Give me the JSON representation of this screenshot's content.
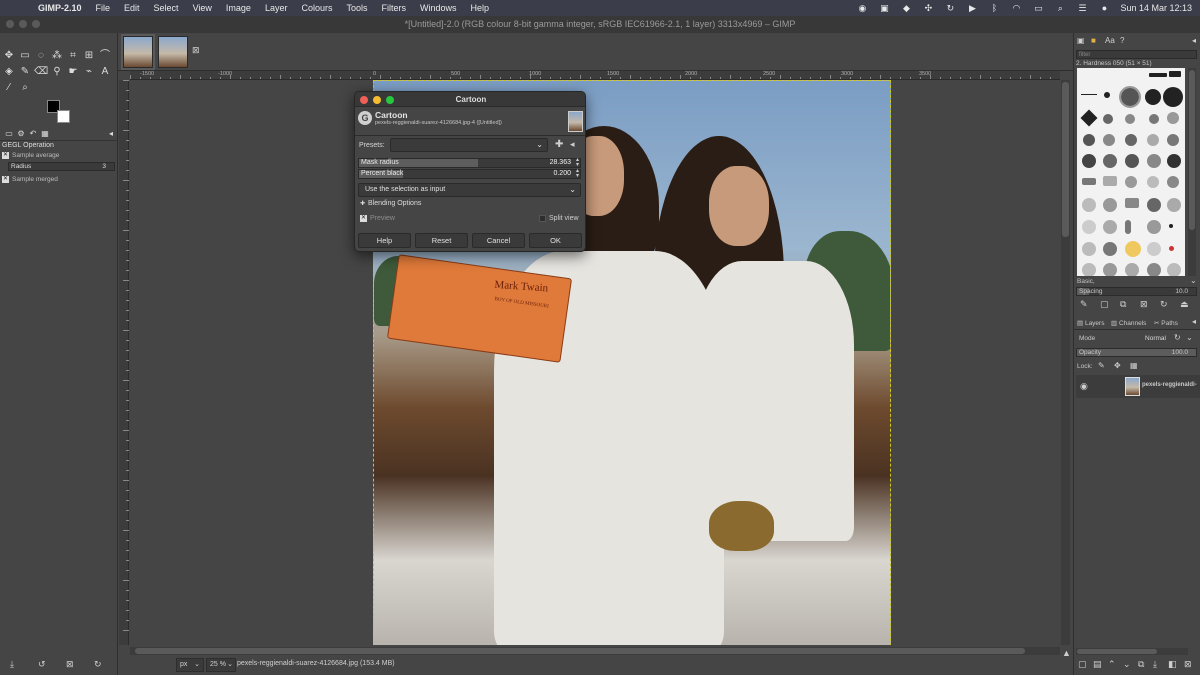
{
  "menubar": {
    "app": "GIMP-2.10",
    "items": [
      "File",
      "Edit",
      "Select",
      "View",
      "Image",
      "Layer",
      "Colours",
      "Tools",
      "Filters",
      "Windows",
      "Help"
    ],
    "clock": "Sun 14 Mar  12:13"
  },
  "window": {
    "title": "*[Untitled]-2.0 (RGB colour 8-bit gamma integer, sRGB IEC61966-2.1, 1 layer) 3313x4969 – GIMP"
  },
  "tool_options": {
    "title": "GEGL Operation",
    "sample_average": "Sample average",
    "radius_label": "Radius",
    "radius_value": "3",
    "sample_merged": "Sample merged"
  },
  "ruler": {
    "h_ticks": [
      "-1500",
      "-1000",
      "0",
      "500",
      "1000",
      "1500",
      "2000",
      "2500",
      "3000",
      "3500"
    ]
  },
  "photo": {
    "book_title": "Mark Twain",
    "book_subtitle": "BOY OF OLD MISSOURI"
  },
  "statusbar": {
    "unit": "px",
    "zoom": "25 %",
    "file_info": "pexels-reggienaldi-suarez-4126684.jpg (153.4 MB)"
  },
  "dialog": {
    "window_title": "Cartoon",
    "header_title": "Cartoon",
    "header_subtitle": "pexels-reggienaldi-suarez-4126684.jpg-4 ([Untitled])",
    "presets_label": "Presets:",
    "presets_value": "",
    "mask_radius_label": "Mask radius",
    "mask_radius_value": "28.363",
    "mask_radius_fraction": 0.54,
    "percent_black_label": "Percent black",
    "percent_black_value": "0.200",
    "percent_black_fraction": 0.2,
    "input_mode": "Use the selection as input",
    "blending_options": "Blending Options",
    "preview_label": "Preview",
    "split_view_label": "Split view",
    "buttons": {
      "help": "Help",
      "reset": "Reset",
      "cancel": "Cancel",
      "ok": "OK"
    }
  },
  "dock": {
    "filter_placeholder": "filter",
    "brush_name": "2. Hardness 050 (51 × 51)",
    "brush_category": "Basic,",
    "spacing_label": "Spacing",
    "spacing_value": "10.0",
    "spacing_fraction": 0.1,
    "tabs": [
      "Layers",
      "Channels",
      "Paths"
    ],
    "mode_label": "Mode",
    "mode_value": "Normal",
    "opacity_label": "Opacity",
    "opacity_value": "100.0",
    "lock_label": "Lock:",
    "layer_name": "pexels-reggienaldi-"
  },
  "colors": {
    "foreground": "#000000",
    "background": "#ffffff",
    "selection_border": "#c8c820"
  }
}
